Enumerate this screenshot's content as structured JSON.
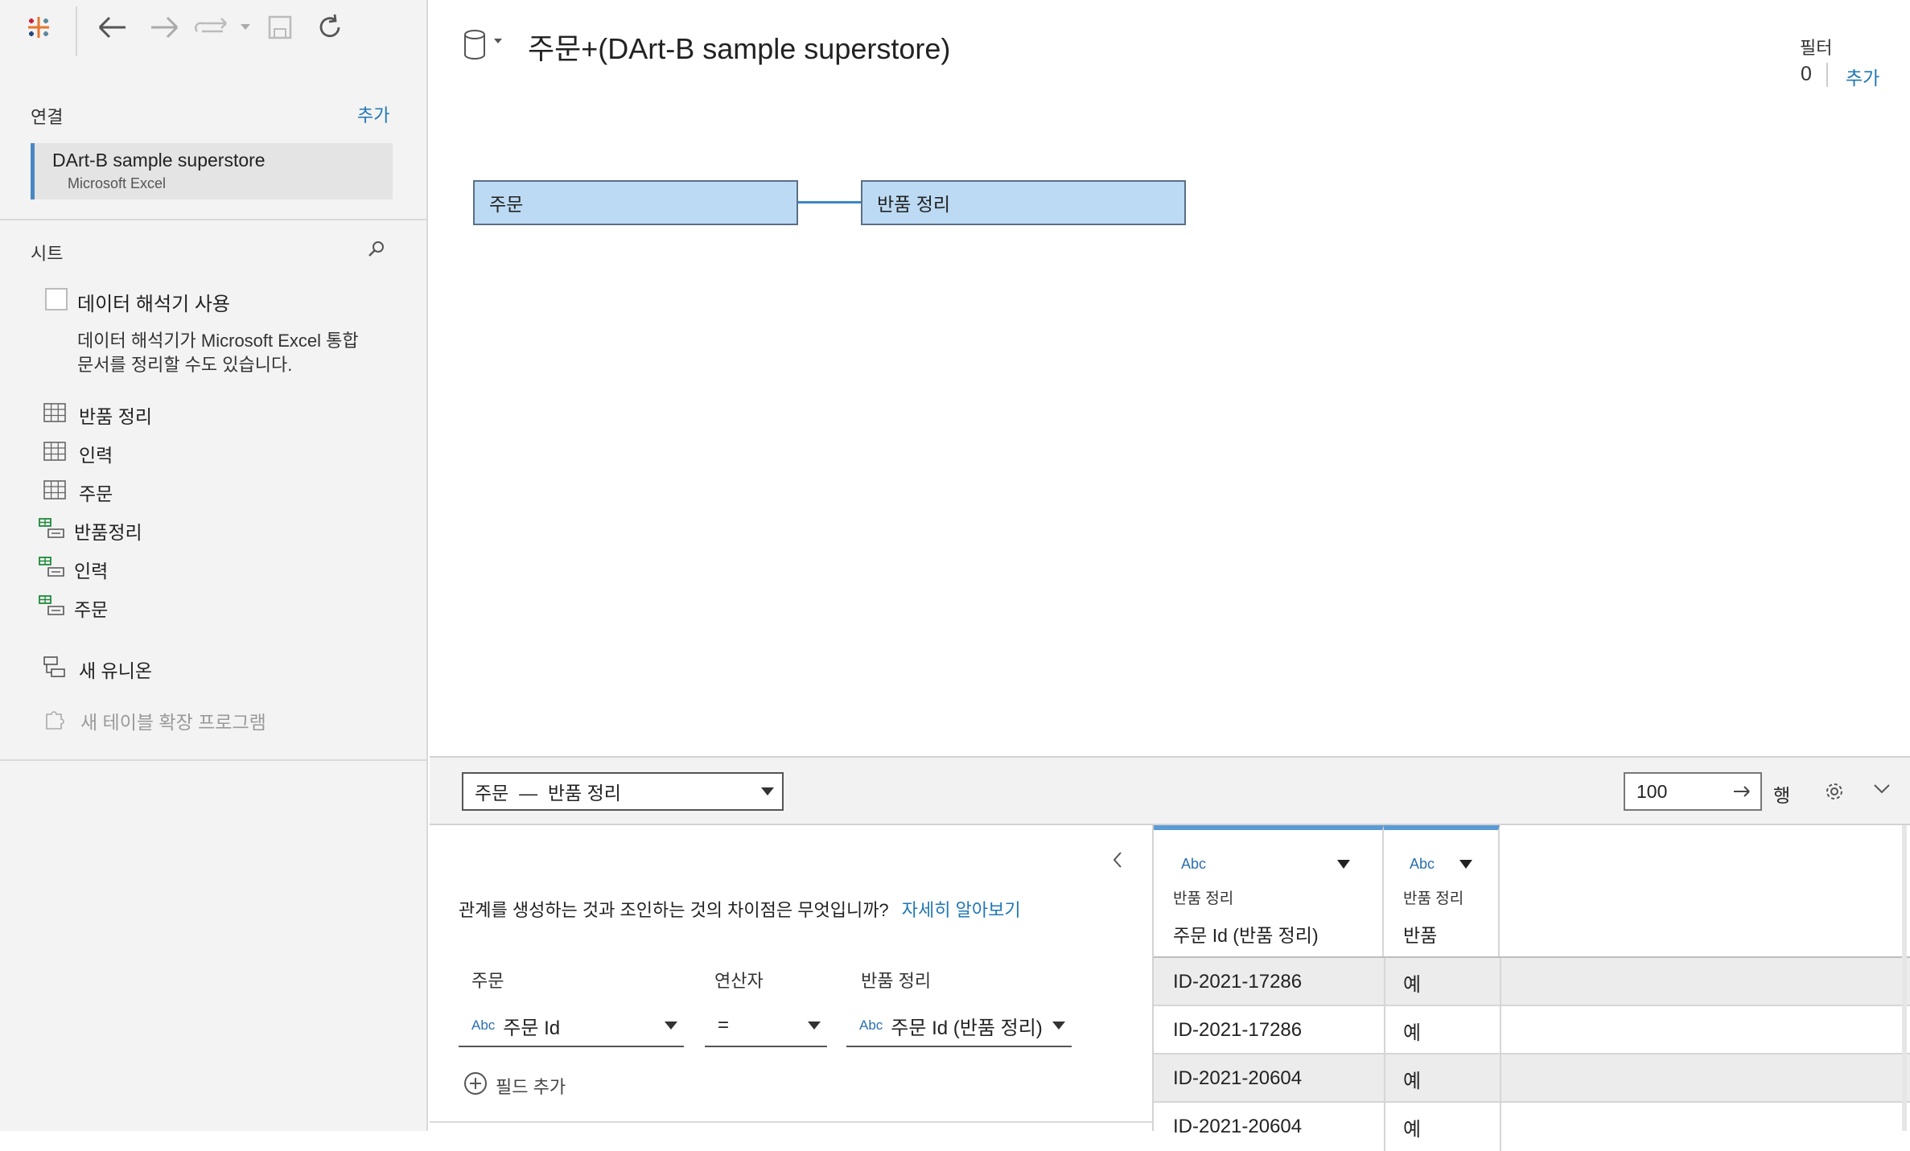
{
  "toolbar": {
    "icons": [
      "tableau-logo-icon",
      "back-icon",
      "forward-icon",
      "redo-icon",
      "dropdown-icon",
      "save-icon",
      "refresh-icon"
    ]
  },
  "connections": {
    "title": "연결",
    "add_label": "추가",
    "item": {
      "name": "DArt-B sample superstore",
      "type": "Microsoft Excel"
    }
  },
  "sheets": {
    "title": "시트",
    "interpreter_label": "데이터 해석기 사용",
    "interpreter_desc_line1": "데이터 해석기가 Microsoft Excel 통합",
    "interpreter_desc_line2": "문서를 정리할 수도 있습니다.",
    "items": [
      {
        "label": "반품 정리",
        "icon": "sheet-table-icon"
      },
      {
        "label": "인력",
        "icon": "sheet-table-icon"
      },
      {
        "label": "주문",
        "icon": "sheet-table-icon"
      },
      {
        "label": "반품정리",
        "icon": "named-range-icon"
      },
      {
        "label": "인력",
        "icon": "named-range-icon"
      },
      {
        "label": "주문",
        "icon": "named-range-icon"
      }
    ],
    "new_union": "새 유니온",
    "new_extension": "새 테이블 확장 프로그램"
  },
  "canvas": {
    "title": "주문+(DArt-B sample superstore)",
    "filter_label": "필터",
    "filter_count": "0",
    "filter_add": "추가",
    "left_table": "주문",
    "right_table": "반품 정리"
  },
  "bottom_bar": {
    "relationship_select": "주문  —  반품 정리",
    "rows_value": "100",
    "rows_label": "행"
  },
  "relationship": {
    "question": "관계를 생성하는 것과 조인하는 것의 차이점은 무엇입니까?",
    "learn_more": "자세히 알아보기",
    "left_header": "주문",
    "operator_header": "연산자",
    "right_header": "반품 정리",
    "left_type": "Abc",
    "left_field": "주문 Id",
    "operator": "=",
    "right_type": "Abc",
    "right_field": "주문 Id (반품 정리)",
    "add_field": "필드 추가"
  },
  "grid": {
    "columns": [
      {
        "type": "Abc",
        "source": "반품 정리",
        "name": "주문 Id (반품 정리)"
      },
      {
        "type": "Abc",
        "source": "반품 정리",
        "name": "반품"
      }
    ],
    "rows": [
      [
        "ID-2021-17286",
        "예"
      ],
      [
        "ID-2021-17286",
        "예"
      ],
      [
        "ID-2021-20604",
        "예"
      ],
      [
        "ID-2021-20604",
        "예"
      ]
    ]
  },
  "colors": {
    "accent": "#1f77b4",
    "table_box": "#bcdaf3",
    "connection_bar": "#4a86c5",
    "grid_header_accent": "#5b9bd5"
  }
}
